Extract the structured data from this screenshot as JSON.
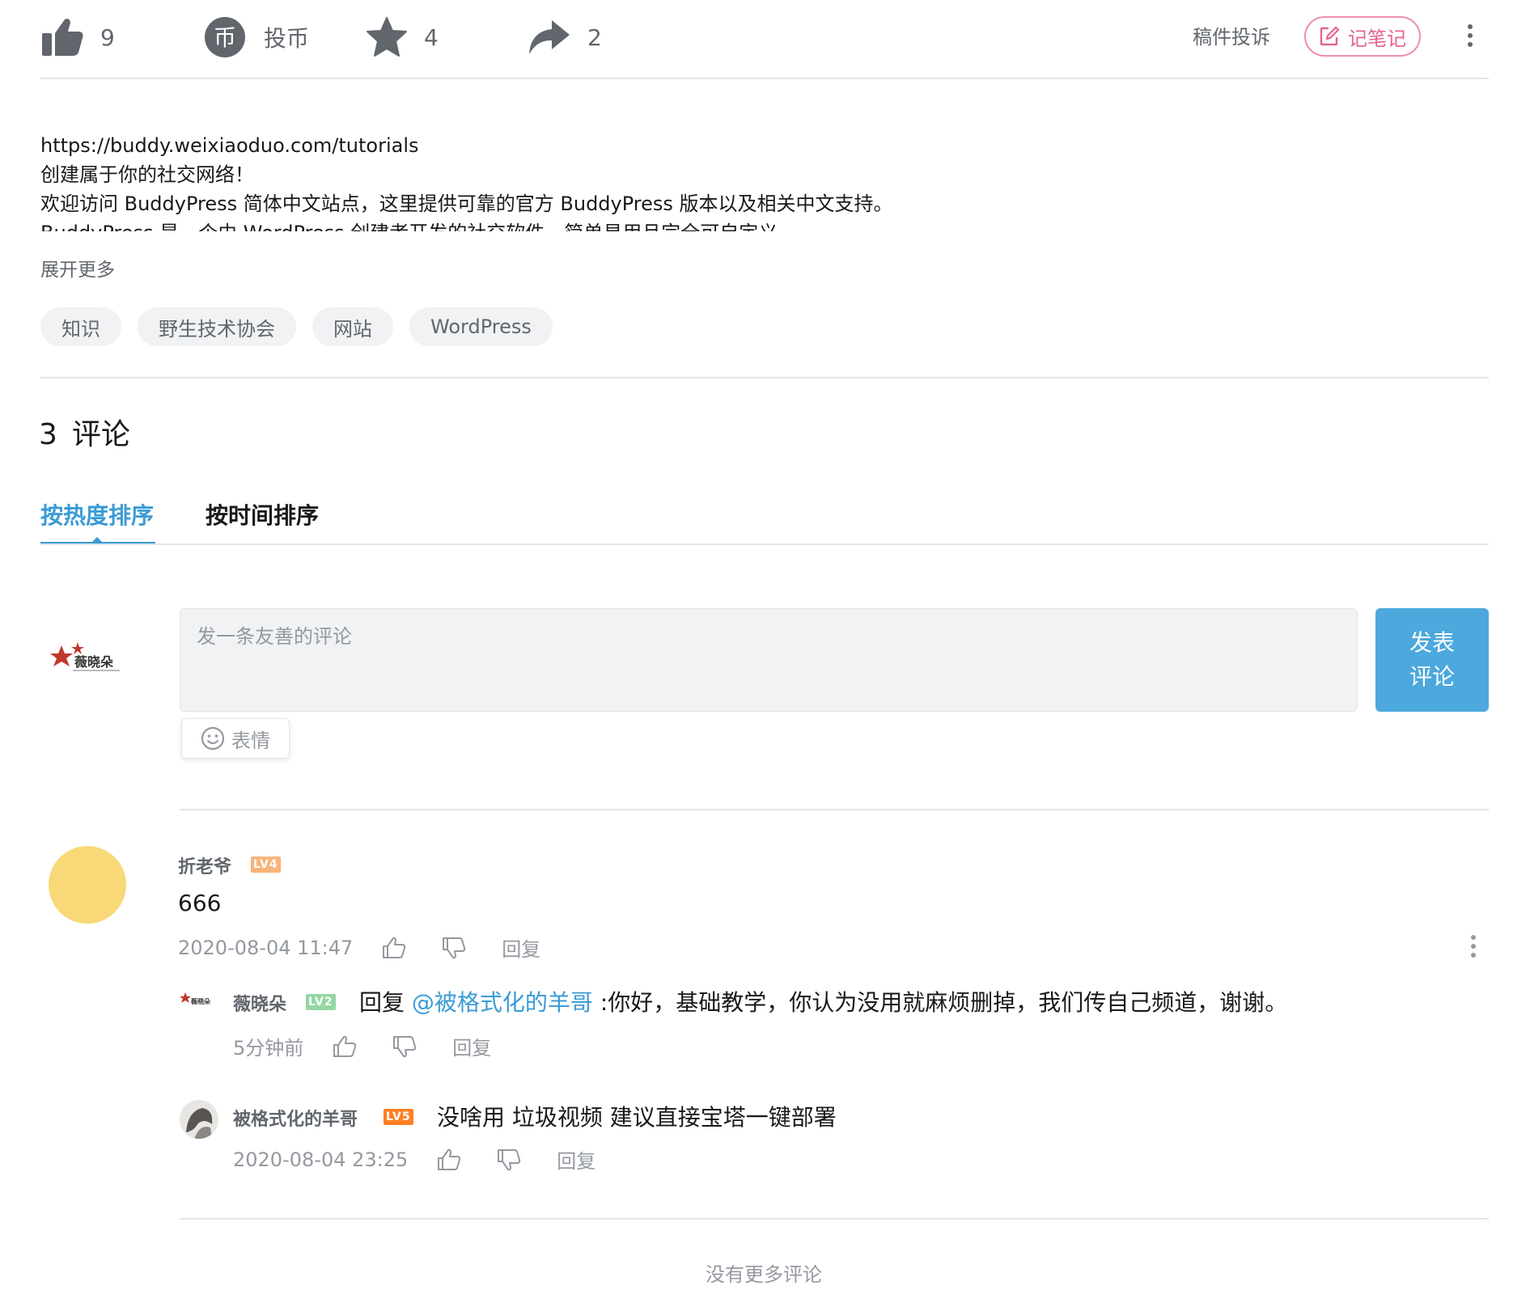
{
  "toolbar": {
    "like_count": "9",
    "coin_label": "投币",
    "coin_glyph": "币",
    "favorite_count": "4",
    "share_count": "2",
    "report_label": "稿件投诉",
    "note_label": "记笔记"
  },
  "description": {
    "lines": [
      "https://buddy.weixiaoduo.com/tutorials",
      "创建属于你的社交网络！",
      "欢迎访问 BuddyPress 简体中文站点，这里提供可靠的官方 BuddyPress 版本以及相关中文支持。",
      "BuddyPress 是一个由 WordPress 创建者开发的社交软件，简单易用且完全可自定义。"
    ],
    "expand_label": "展开更多"
  },
  "tags": [
    "知识",
    "野生技术协会",
    "网站",
    "WordPress"
  ],
  "comments_header": {
    "count": "3",
    "label": "评论",
    "tabs": [
      "按热度排序",
      "按时间排序"
    ]
  },
  "compose": {
    "avatar_text": "薇晓朵",
    "placeholder": "发一条友善的评论",
    "post_line1": "发表",
    "post_line2": "评论",
    "emoji_label": "表情"
  },
  "comments": [
    {
      "user": "折老爷",
      "level": "LV4",
      "text": "666",
      "time": "2020-08-04 11:47",
      "reply_label": "回复",
      "replies": [
        {
          "user": "薇晓朵",
          "level": "LV2",
          "prefix": "回复",
          "mention": "@被格式化的羊哥",
          "text": ":你好，基础教学，你认为没用就麻烦删掉，我们传自己频道，谢谢。",
          "time": "5分钟前",
          "reply_label": "回复"
        },
        {
          "user": "被格式化的羊哥",
          "level": "LV5",
          "text": "没啥用 垃圾视频 建议直接宝塔一键部署",
          "time": "2020-08-04 23:25",
          "reply_label": "回复"
        }
      ]
    }
  ],
  "footer": {
    "no_more": "没有更多评论"
  },
  "colors": {
    "accent_blue": "#3a9bd5",
    "pink": "#e5648f",
    "lv4": "#f7b37a",
    "lv2": "#95d6a4",
    "lv5": "#ff7f24"
  }
}
